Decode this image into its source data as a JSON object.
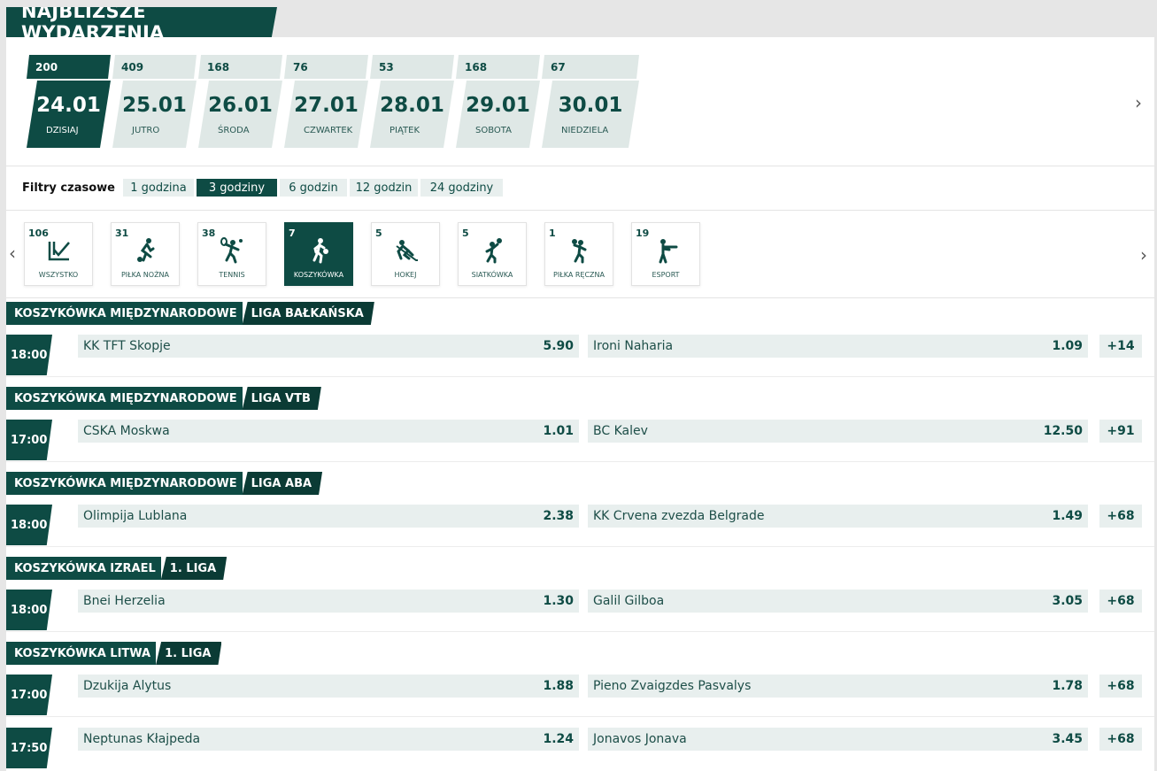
{
  "title": "NAJBLIŻSZE WYDARZENIA",
  "dates": [
    {
      "count": "200",
      "date": "24.01",
      "day": "DZISIAJ",
      "active": true
    },
    {
      "count": "409",
      "date": "25.01",
      "day": "JUTRO"
    },
    {
      "count": "168",
      "date": "26.01",
      "day": "ŚRODA"
    },
    {
      "count": "76",
      "date": "27.01",
      "day": "CZWARTEK"
    },
    {
      "count": "53",
      "date": "28.01",
      "day": "PIĄTEK"
    },
    {
      "count": "168",
      "date": "29.01",
      "day": "SOBOTA"
    },
    {
      "count": "67",
      "date": "30.01",
      "day": "NIEDZIELA"
    }
  ],
  "time_filters": {
    "label": "Filtry czasowe",
    "options": [
      "1 godzina",
      "3 godziny",
      "6 godzin",
      "12 godzin",
      "24 godziny"
    ],
    "selected": "3 godziny"
  },
  "sports": [
    {
      "count": "106",
      "label": "WSZYSTKO",
      "icon": "all-icon"
    },
    {
      "count": "31",
      "label": "PIŁKA NOŻNA",
      "icon": "football-icon"
    },
    {
      "count": "38",
      "label": "TENNIS",
      "icon": "tennis-icon"
    },
    {
      "count": "7",
      "label": "KOSZYKÓWKA",
      "icon": "basketball-icon",
      "active": true
    },
    {
      "count": "5",
      "label": "HOKEJ",
      "icon": "hockey-icon"
    },
    {
      "count": "5",
      "label": "SIATKÓWKA",
      "icon": "volleyball-icon"
    },
    {
      "count": "1",
      "label": "PIŁKA RĘCZNA",
      "icon": "handball-icon"
    },
    {
      "count": "19",
      "label": "ESPORT",
      "icon": "esport-icon"
    }
  ],
  "leagues": [
    {
      "sport": "KOSZYKÓWKA MIĘDZYNARODOWE",
      "name": "LIGA BAŁKAŃSKA",
      "events": [
        {
          "time": "18:00",
          "home": "KK TFT Skopje",
          "home_odd": "5.90",
          "away": "Ironi Naharia",
          "away_odd": "1.09",
          "more": "+14"
        }
      ]
    },
    {
      "sport": "KOSZYKÓWKA MIĘDZYNARODOWE",
      "name": "LIGA VTB",
      "events": [
        {
          "time": "17:00",
          "home": "CSKA Moskwa",
          "home_odd": "1.01",
          "away": "BC Kalev",
          "away_odd": "12.50",
          "more": "+91"
        }
      ]
    },
    {
      "sport": "KOSZYKÓWKA MIĘDZYNARODOWE",
      "name": "LIGA ABA",
      "events": [
        {
          "time": "18:00",
          "home": "Olimpija Lublana",
          "home_odd": "2.38",
          "away": "KK Crvena zvezda Belgrade",
          "away_odd": "1.49",
          "more": "+68"
        }
      ]
    },
    {
      "sport": "KOSZYKÓWKA IZRAEL",
      "name": "1. LIGA",
      "events": [
        {
          "time": "18:00",
          "home": "Bnei Herzelia",
          "home_odd": "1.30",
          "away": "Galil Gilboa",
          "away_odd": "3.05",
          "more": "+68"
        }
      ]
    },
    {
      "sport": "KOSZYKÓWKA LITWA",
      "name": "1. LIGA",
      "events": [
        {
          "time": "17:00",
          "home": "Dzukija Alytus",
          "home_odd": "1.88",
          "away": "Pieno Zvaigzdes Pasvalys",
          "away_odd": "1.78",
          "more": "+68"
        },
        {
          "time": "17:50",
          "home": "Neptunas Kłajpeda",
          "home_odd": "1.24",
          "away": "Jonavos Jonava",
          "away_odd": "3.45",
          "more": "+68"
        }
      ]
    }
  ],
  "colors": {
    "primary": "#0e4b44",
    "cell": "#e8efee",
    "background": "#e6e6e6"
  }
}
